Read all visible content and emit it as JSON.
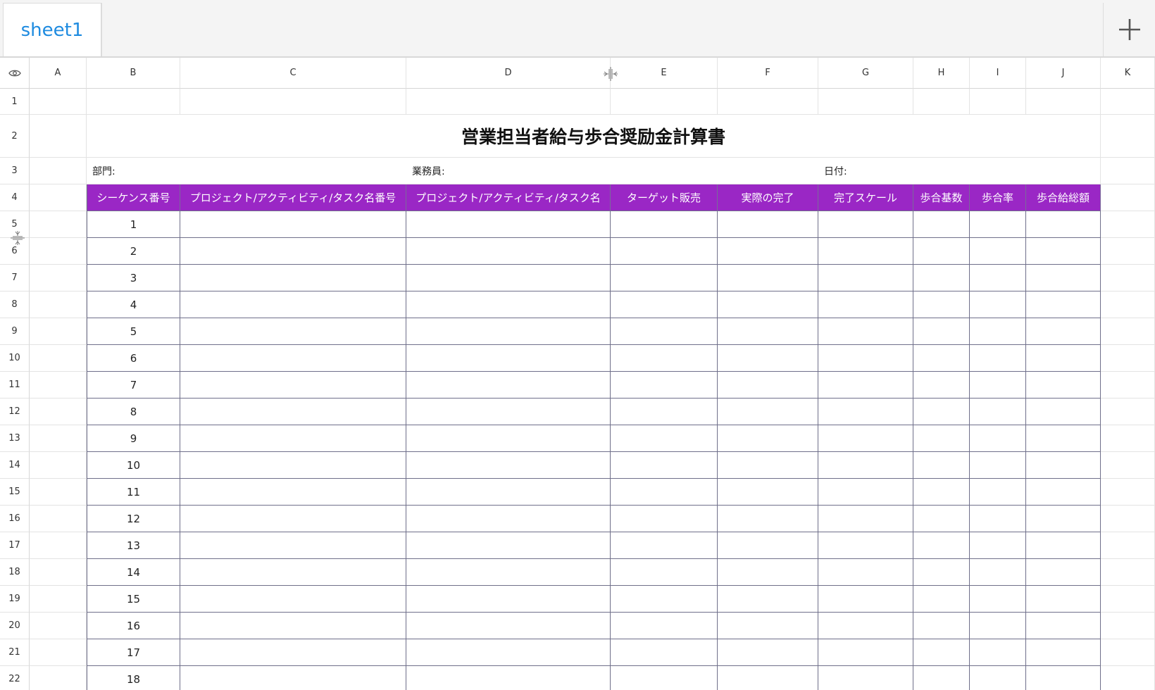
{
  "tabs": {
    "active_tab": "sheet1"
  },
  "columns": [
    "A",
    "B",
    "C",
    "D",
    "E",
    "F",
    "G",
    "H",
    "I",
    "J",
    "K"
  ],
  "rows": [
    "1",
    "2",
    "3",
    "4",
    "5",
    "6",
    "7",
    "8",
    "9",
    "10",
    "11",
    "12",
    "13",
    "14",
    "15",
    "16",
    "17",
    "18",
    "19",
    "20",
    "21",
    "22"
  ],
  "sheet": {
    "title": "営業担当者給与歩合奨励金計算書",
    "department_label": "部門:",
    "salesperson_label": "業務員:",
    "date_label": "日付:",
    "headers": [
      "シーケンス番号",
      "プロジェクト/アクティビティ/タスク名番号",
      "プロジェクト/アクティビティ/タスク名",
      "ターゲット販売",
      "実際の完了",
      "完了スケール",
      "歩合基数",
      "歩合率",
      "歩合給総額"
    ],
    "sequence_numbers": [
      "1",
      "2",
      "3",
      "4",
      "5",
      "6",
      "7",
      "8",
      "9",
      "10",
      "11",
      "12",
      "13",
      "14",
      "15",
      "16",
      "17",
      "18"
    ]
  },
  "colors": {
    "header_bg": "#9a27c5",
    "tab_text": "#1e8be0",
    "border": "#6f6f8a"
  },
  "icons": {
    "visibility": "eye-icon",
    "add_sheet": "plus-icon",
    "col_resize": "column-resize-icon",
    "row_resize": "row-resize-icon"
  }
}
